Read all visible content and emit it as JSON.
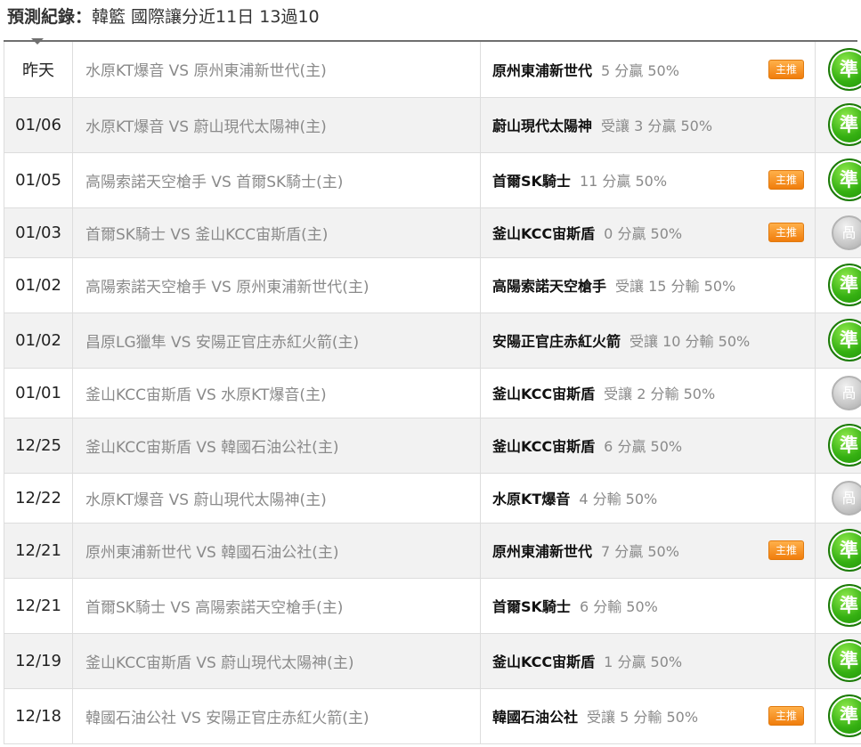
{
  "header": {
    "title_label": "預測紀錄：",
    "title_text": "韓籃 國際讓分近11日 13過10"
  },
  "colors": {
    "win": "#35b012",
    "draw": "#c8c8c8",
    "badge": "#f07d0c",
    "row_alt": "#f2f2f2"
  },
  "records": [
    {
      "date": "昨天",
      "match": "水原KT爆音 VS 原州東浦新世代(主)",
      "pick_team": "原州東浦新世代",
      "pick_detail": "5 分贏 50%",
      "badge": "主推",
      "result": "準",
      "result_type": "win"
    },
    {
      "date": "01/06",
      "match": "水原KT爆音 VS 蔚山現代太陽神(主)",
      "pick_team": "蔚山現代太陽神",
      "pick_detail": "受讓 3 分贏 50%",
      "badge": "",
      "result": "準",
      "result_type": "win"
    },
    {
      "date": "01/05",
      "match": "高陽索諾天空槍手 VS 首爾SK騎士(主)",
      "pick_team": "首爾SK騎士",
      "pick_detail": "11 分贏 50%",
      "badge": "主推",
      "result": "準",
      "result_type": "win"
    },
    {
      "date": "01/03",
      "match": "首爾SK騎士 VS 釜山KCC宙斯盾(主)",
      "pick_team": "釜山KCC宙斯盾",
      "pick_detail": "0 分贏 50%",
      "badge": "主推",
      "result": "咼",
      "result_type": "draw"
    },
    {
      "date": "01/02",
      "match": "高陽索諾天空槍手 VS 原州東浦新世代(主)",
      "pick_team": "高陽索諾天空槍手",
      "pick_detail": "受讓 15 分輸 50%",
      "badge": "",
      "result": "準",
      "result_type": "win"
    },
    {
      "date": "01/02",
      "match": "昌原LG獵隼 VS 安陽正官庄赤紅火箭(主)",
      "pick_team": "安陽正官庄赤紅火箭",
      "pick_detail": "受讓 10 分輸 50%",
      "badge": "",
      "result": "準",
      "result_type": "win"
    },
    {
      "date": "01/01",
      "match": "釜山KCC宙斯盾 VS 水原KT爆音(主)",
      "pick_team": "釜山KCC宙斯盾",
      "pick_detail": "受讓 2 分輸 50%",
      "badge": "",
      "result": "咼",
      "result_type": "draw"
    },
    {
      "date": "12/25",
      "match": "釜山KCC宙斯盾 VS 韓國石油公社(主)",
      "pick_team": "釜山KCC宙斯盾",
      "pick_detail": "6 分贏 50%",
      "badge": "",
      "result": "準",
      "result_type": "win"
    },
    {
      "date": "12/22",
      "match": "水原KT爆音 VS 蔚山現代太陽神(主)",
      "pick_team": "水原KT爆音",
      "pick_detail": "4 分輸 50%",
      "badge": "",
      "result": "咼",
      "result_type": "draw"
    },
    {
      "date": "12/21",
      "match": "原州東浦新世代 VS 韓國石油公社(主)",
      "pick_team": "原州東浦新世代",
      "pick_detail": "7 分贏 50%",
      "badge": "主推",
      "result": "準",
      "result_type": "win"
    },
    {
      "date": "12/21",
      "match": "首爾SK騎士 VS 高陽索諾天空槍手(主)",
      "pick_team": "首爾SK騎士",
      "pick_detail": "6 分輸 50%",
      "badge": "",
      "result": "準",
      "result_type": "win"
    },
    {
      "date": "12/19",
      "match": "釜山KCC宙斯盾 VS 蔚山現代太陽神(主)",
      "pick_team": "釜山KCC宙斯盾",
      "pick_detail": "1 分贏 50%",
      "badge": "",
      "result": "準",
      "result_type": "win"
    },
    {
      "date": "12/18",
      "match": "韓國石油公社 VS 安陽正官庄赤紅火箭(主)",
      "pick_team": "韓國石油公社",
      "pick_detail": "受讓 5 分輸 50%",
      "badge": "主推",
      "result": "準",
      "result_type": "win"
    }
  ]
}
